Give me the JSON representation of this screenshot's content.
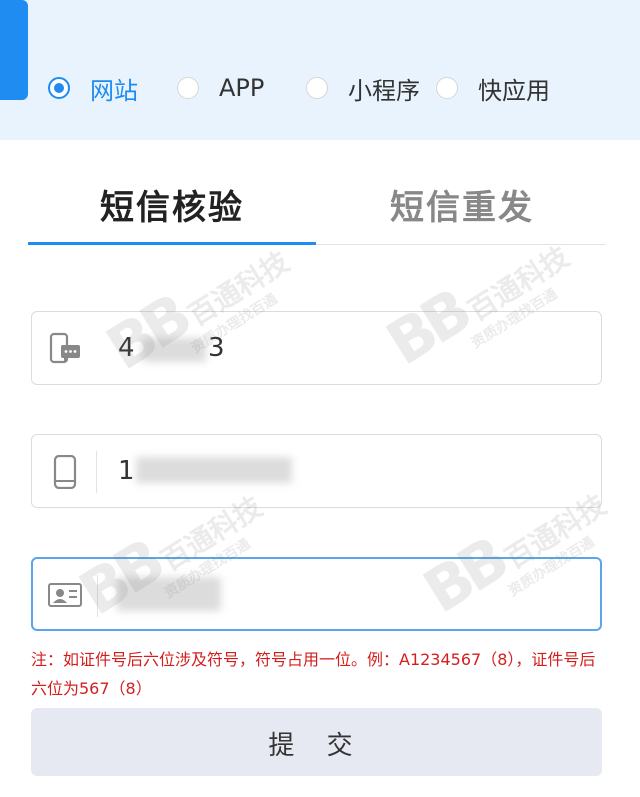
{
  "platform_options": [
    {
      "label": "网站",
      "checked": true
    },
    {
      "label": "APP",
      "checked": false
    },
    {
      "label": "小程序",
      "checked": false
    },
    {
      "label": "快应用",
      "checked": false
    }
  ],
  "tabs": {
    "verify": "短信核验",
    "resend": "短信重发"
  },
  "form": {
    "sms_code_value": "4",
    "sms_code_value_tail": "3",
    "phone_value": "1",
    "id_value": ""
  },
  "note": "注：如证件号后六位涉及符号，符号占用一位。例：A1234567（8），证件号后六位为567（8）",
  "submit_label": "提 交",
  "watermark": {
    "logo": "BB",
    "name": "百通科技",
    "slogan": "资质办理找百通"
  },
  "colors": {
    "accent": "#1e8cf0",
    "header_bg": "#e9f3fe",
    "note": "#d41e1e",
    "submit_bg": "#e6e9f2"
  }
}
